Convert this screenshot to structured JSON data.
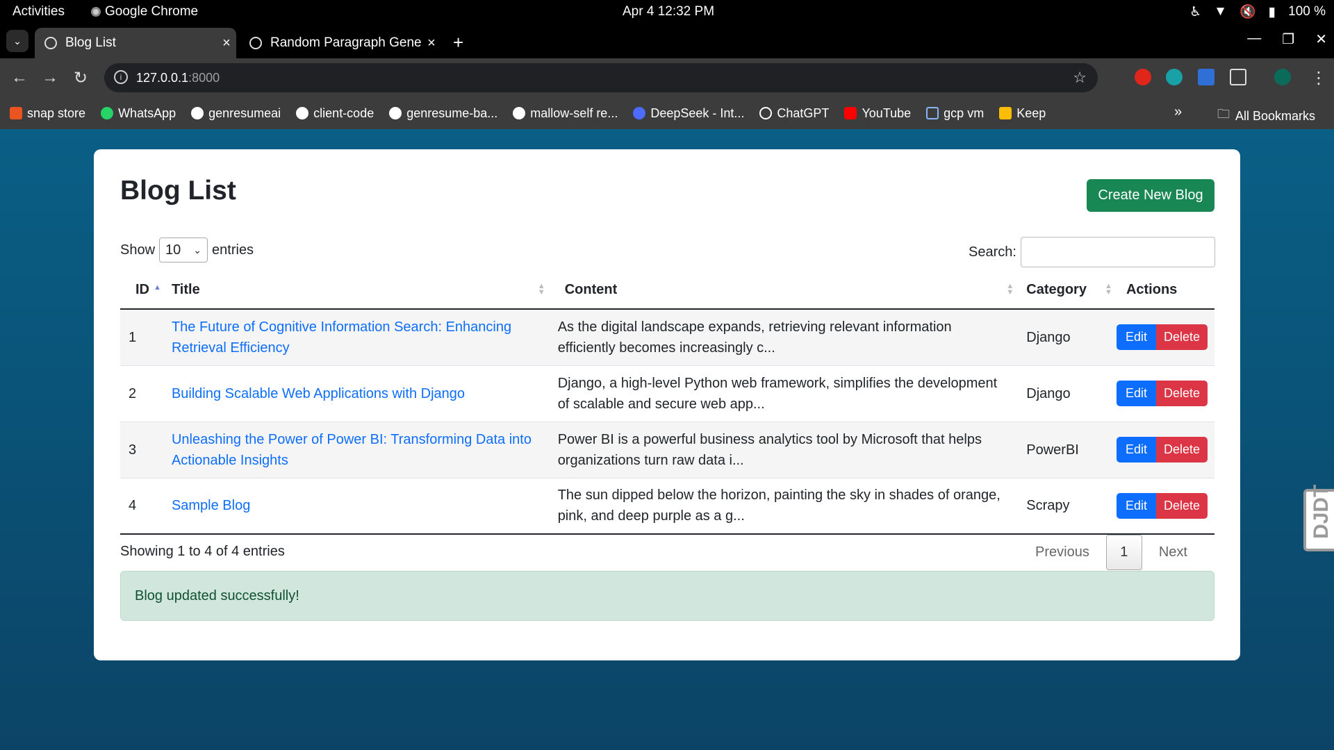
{
  "system": {
    "activities": "Activities",
    "app_name": "Google Chrome",
    "clock": "Apr 4  12:32 PM",
    "battery": "100 %"
  },
  "tabs": [
    {
      "title": "Blog List"
    },
    {
      "title": "Random Paragraph Gene"
    }
  ],
  "toolbar": {
    "url_host": "127.0.0.1",
    "url_port": ":8000"
  },
  "bookmarks": [
    {
      "label": "snap store",
      "icon": "snap-icon",
      "color": "#e95420"
    },
    {
      "label": "WhatsApp",
      "icon": "whatsapp-icon",
      "color": "#25d366"
    },
    {
      "label": "genresumeai",
      "icon": "github-icon",
      "color": "#ffffff"
    },
    {
      "label": "client-code",
      "icon": "github-icon",
      "color": "#ffffff"
    },
    {
      "label": "genresume-ba...",
      "icon": "github-icon",
      "color": "#ffffff"
    },
    {
      "label": "mallow-self re...",
      "icon": "github-icon",
      "color": "#ffffff"
    },
    {
      "label": "DeepSeek - Int...",
      "icon": "deepseek-icon",
      "color": "#4d6bfe"
    },
    {
      "label": "ChatGPT",
      "icon": "chatgpt-icon",
      "color": "#ffffff"
    },
    {
      "label": "YouTube",
      "icon": "youtube-icon",
      "color": "#ff0000"
    },
    {
      "label": "gcp vm",
      "icon": "gcp-icon",
      "color": "#8ab4f8"
    },
    {
      "label": "Keep",
      "icon": "keep-icon",
      "color": "#fbbc04"
    }
  ],
  "bookmarks_all": "All Bookmarks",
  "page": {
    "heading": "Blog List",
    "create_button": "Create New Blog",
    "show_label": "Show",
    "entries_value": "10",
    "entries_label": "entries",
    "search_label": "Search:",
    "columns": [
      "ID",
      "Title",
      "Content",
      "Category",
      "Actions"
    ],
    "rows": [
      {
        "id": "1",
        "title": "The Future of Cognitive Information Search: Enhancing Retrieval Efficiency",
        "content": "As the digital landscape expands, retrieving relevant information efficiently becomes increasingly c...",
        "category": "Django"
      },
      {
        "id": "2",
        "title": "Building Scalable Web Applications with Django",
        "content": "Django, a high-level Python web framework, simplifies the development of scalable and secure web app...",
        "category": "Django"
      },
      {
        "id": "3",
        "title": "Unleashing the Power of Power BI: Transforming Data into Actionable Insights",
        "content": "Power BI is a powerful business analytics tool by Microsoft that helps organizations turn raw data i...",
        "category": "PowerBI"
      },
      {
        "id": "4",
        "title": "Sample Blog",
        "content": "The sun dipped below the horizon, painting the sky in shades of orange, pink, and deep purple as a g...",
        "category": "Scrapy"
      }
    ],
    "edit_label": "Edit",
    "delete_label": "Delete",
    "info": "Showing 1 to 4 of 4 entries",
    "pagination": {
      "previous": "Previous",
      "current": "1",
      "next": "Next"
    },
    "alert": "Blog updated successfully!",
    "debug_toolbar": "DJDT"
  },
  "colors": {
    "primary": "#0d6efd",
    "success": "#198754",
    "danger": "#dc3545",
    "alert_bg": "#d1e7dd"
  }
}
